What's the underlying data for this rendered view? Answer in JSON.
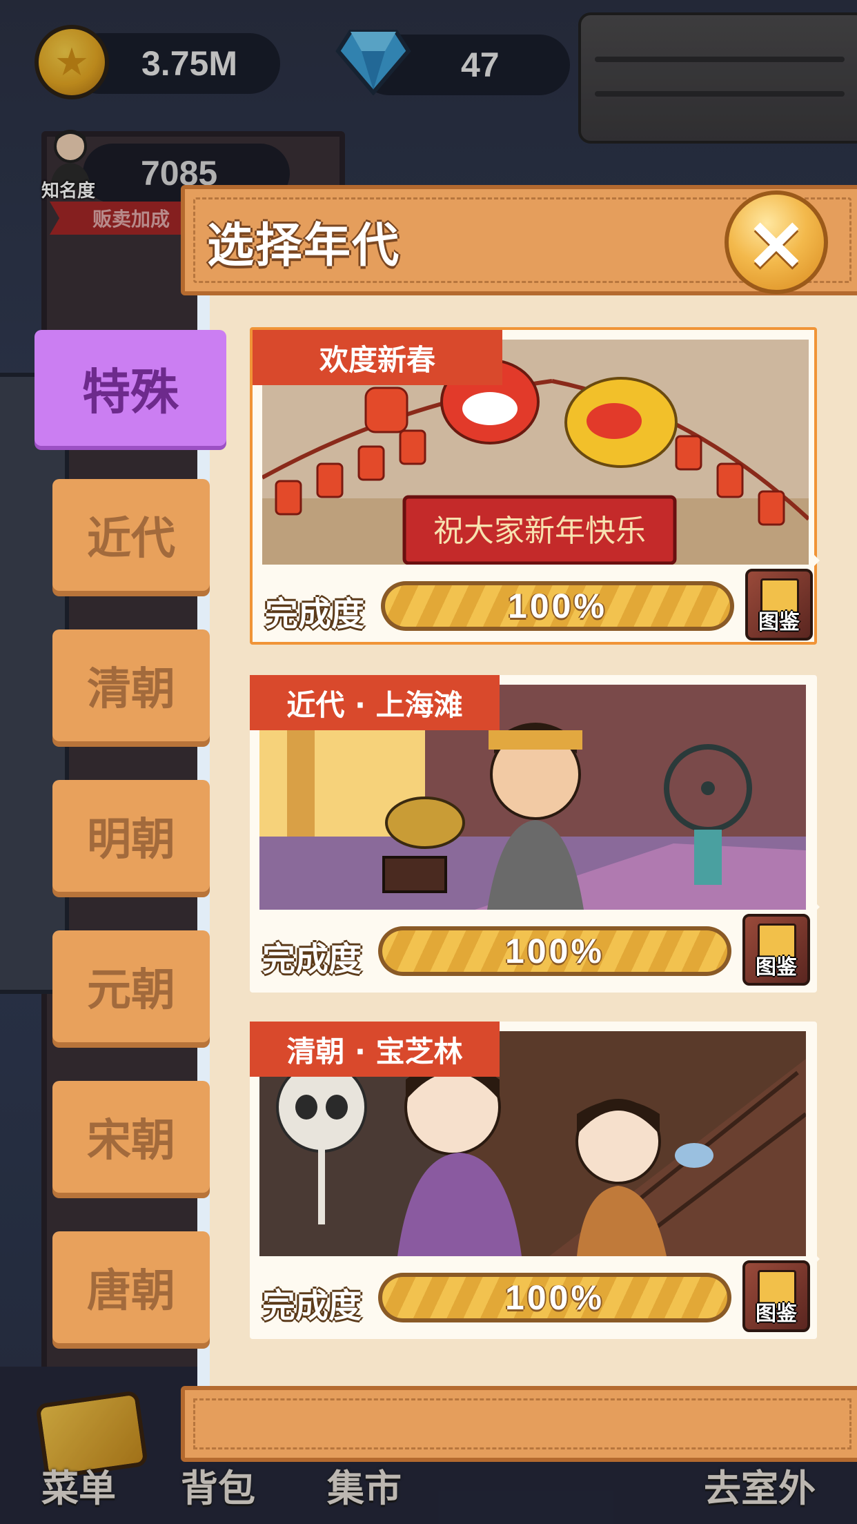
{
  "hud": {
    "coins": "3.75M",
    "gems": "47",
    "fame_value": "7085",
    "fame_label": "知名度",
    "sale_bonus_label": "贩卖加成"
  },
  "dialog": {
    "title": "选择年代",
    "close_label": "×"
  },
  "tabs": [
    {
      "label": "特殊",
      "active": true
    },
    {
      "label": "近代",
      "active": false
    },
    {
      "label": "清朝",
      "active": false
    },
    {
      "label": "明朝",
      "active": false
    },
    {
      "label": "元朝",
      "active": false
    },
    {
      "label": "宋朝",
      "active": false
    },
    {
      "label": "唐朝",
      "active": false
    }
  ],
  "cards": [
    {
      "tag": "欢度新春",
      "banner": "祝大家新年快乐",
      "progress_label": "完成度",
      "progress_text": "100%",
      "progress": 1.0,
      "album_label": "图鉴",
      "selected": true
    },
    {
      "tag": "近代 · 上海滩",
      "progress_label": "完成度",
      "progress_text": "100%",
      "progress": 1.0,
      "album_label": "图鉴",
      "selected": false
    },
    {
      "tag": "清朝 · 宝芝林",
      "progress_label": "完成度",
      "progress_text": "100%",
      "progress": 1.0,
      "album_label": "图鉴",
      "selected": false
    }
  ],
  "bottom_nav": [
    {
      "label": "菜单"
    },
    {
      "label": "背包"
    },
    {
      "label": "集市"
    },
    {
      "label": "去室外"
    }
  ],
  "colors": {
    "accent_orange": "#e59e5c",
    "active_tab": "#cb7ef2",
    "tag_red": "#d9492c",
    "progress_gold": "#f2c24f"
  }
}
